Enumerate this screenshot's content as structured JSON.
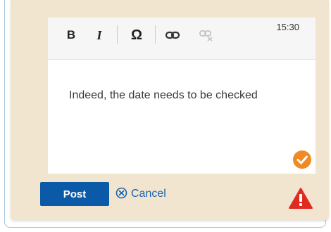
{
  "editor": {
    "timestamp": "15:30",
    "content": "Indeed, the date needs to be checked",
    "toolbar": {
      "bold_label": "B",
      "italic_label": "I",
      "special_char_label": "Ω"
    }
  },
  "actions": {
    "post_label": "Post",
    "cancel_label": "Cancel"
  },
  "colors": {
    "panel_bg": "#f2e5cf",
    "post_button": "#0a5aa8",
    "cancel_link": "#1a63b0",
    "check_badge": "#f08a24",
    "warning": "#e02b20"
  },
  "icons": [
    "link-icon",
    "unlink-icon",
    "check-circle-icon",
    "cancel-circle-icon",
    "warning-icon"
  ]
}
